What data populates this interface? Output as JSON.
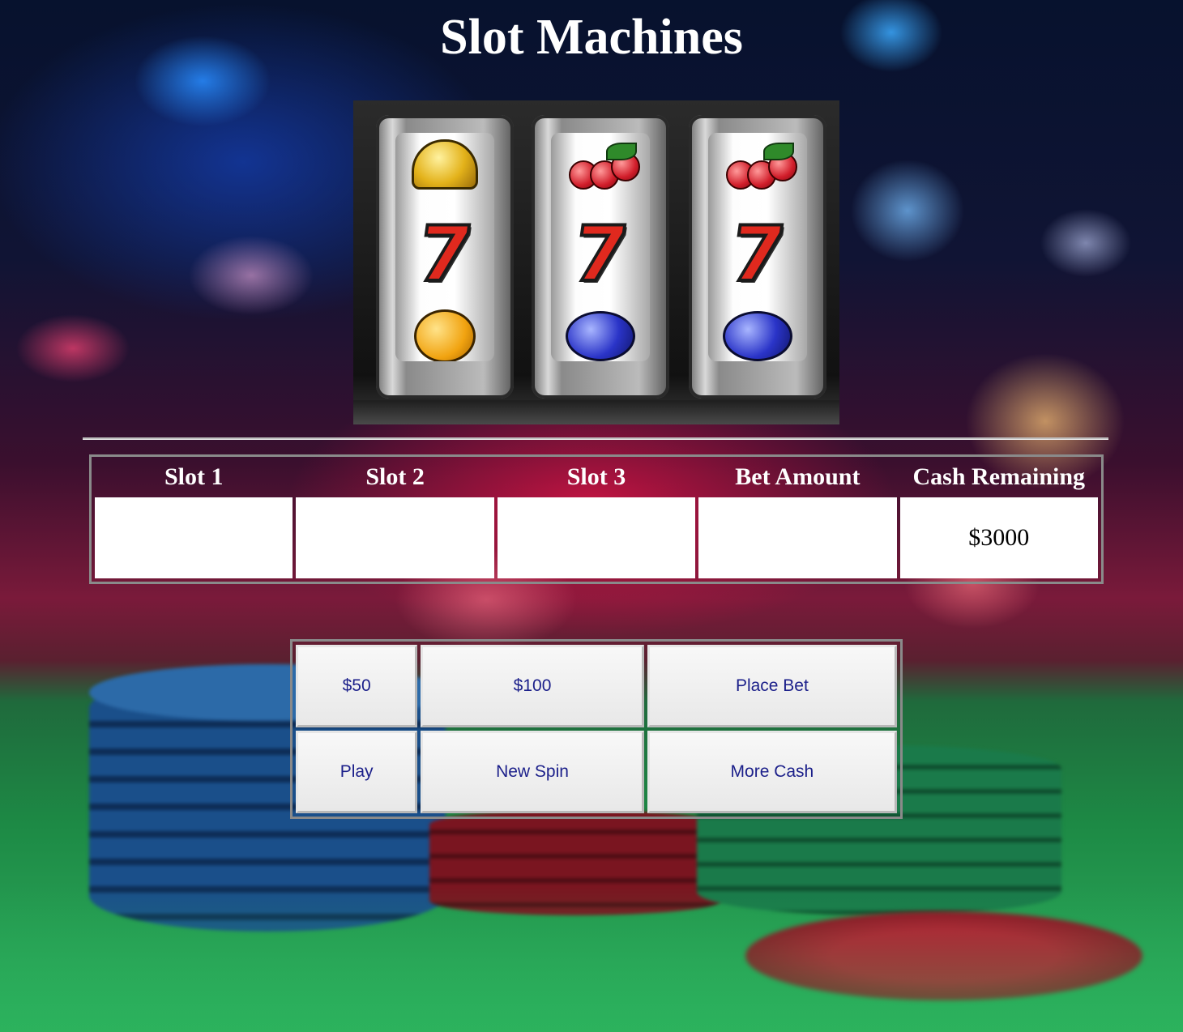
{
  "page": {
    "title": "Slot Machines"
  },
  "results_table": {
    "headers": [
      "Slot 1",
      "Slot 2",
      "Slot 3",
      "Bet Amount",
      "Cash Remaining"
    ],
    "values": [
      "",
      "",
      "",
      "",
      "$3000"
    ]
  },
  "controls": {
    "row1": [
      "$50",
      "$100",
      "Place Bet"
    ],
    "row2": [
      "Play",
      "New Spin",
      "More Cash"
    ]
  },
  "illustration": {
    "reels": [
      [
        "bell-icon",
        "seven-icon",
        "orange-icon"
      ],
      [
        "cherry-icon",
        "seven-icon",
        "plum-icon"
      ],
      [
        "cherry-icon",
        "seven-icon",
        "plum-icon"
      ]
    ],
    "seven_symbol": "7"
  },
  "colors": {
    "heading_text": "#ffffff",
    "button_text": "#1b1f8a",
    "cell_background": "#ffffff",
    "seven_red": "#e0291e"
  }
}
